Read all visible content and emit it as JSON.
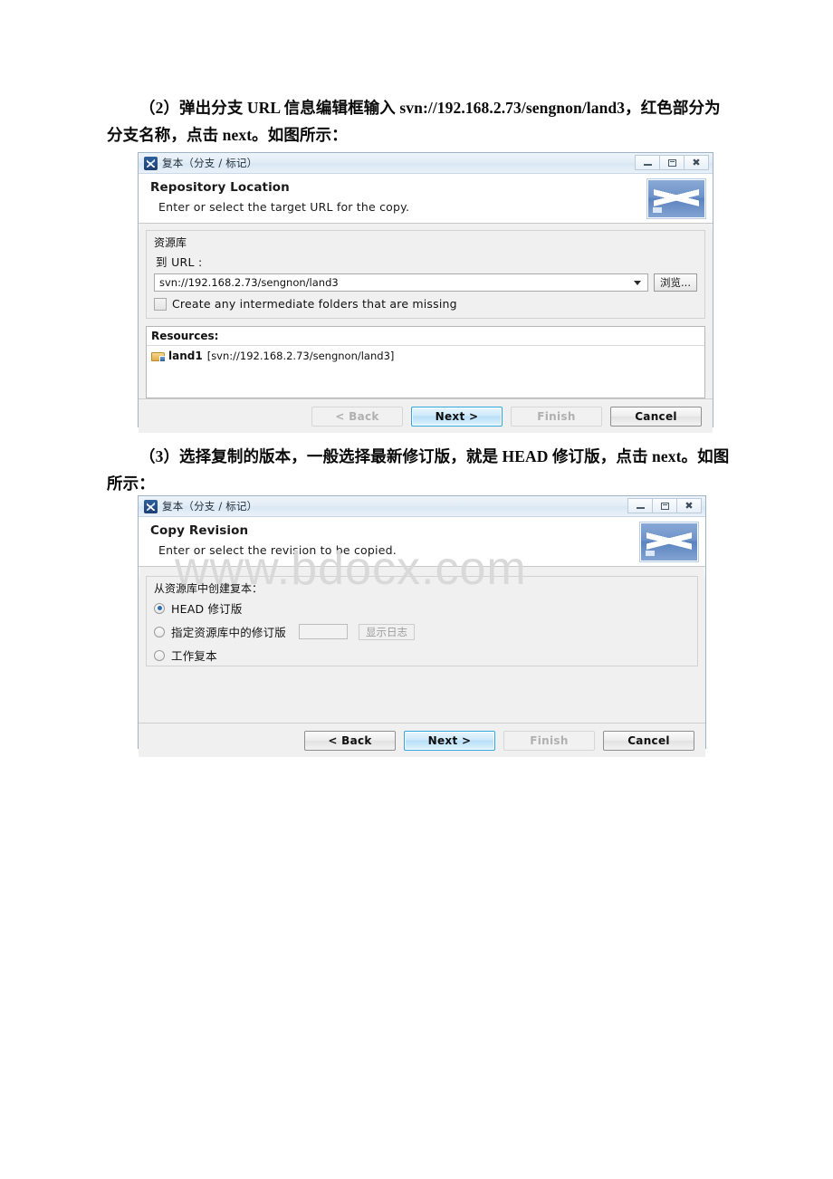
{
  "document": {
    "paragraph_2": "（2）弹出分支 URL 信息编辑框输入 svn://192.168.2.73/sengnon/land3，红色部分为分支名称，点击 next。如图所示：",
    "paragraph_3": "（3）选择复制的版本，一般选择最新修订版，就是 HEAD 修订版，点击 next。如图所示："
  },
  "watermark": {
    "text": "www.bdocx.com",
    "color": "#d8d8d8"
  },
  "dialog1": {
    "titlebar": {
      "title": "复本（分支 / 标记）",
      "icon": "subclipse-icon",
      "minimize_label": "最小化",
      "restore_label": "还原",
      "close_label": "关闭"
    },
    "header": {
      "title": "Repository Location",
      "description": "Enter or select the target URL for the copy.",
      "logo": "svn-logo"
    },
    "group": {
      "label": "资源库",
      "url_field_label": "到 URL :",
      "url_value": "svn://192.168.2.73/sengnon/land3",
      "browse_button": "浏览...",
      "checkbox_label": "Create any intermediate folders that are missing",
      "checkbox_checked": false
    },
    "resources": {
      "title": "Resources:",
      "items": [
        {
          "icon": "folder-icon",
          "name": "land1",
          "url": "[svn://192.168.2.73/sengnon/land3]"
        }
      ]
    },
    "footer": {
      "back": "< Back",
      "back_enabled": false,
      "next": "Next >",
      "next_primary": true,
      "finish": "Finish",
      "finish_enabled": false,
      "cancel": "Cancel"
    }
  },
  "dialog2": {
    "titlebar": {
      "title": "复本（分支 / 标记）",
      "icon": "subclipse-icon",
      "minimize_label": "最小化",
      "restore_label": "还原",
      "close_label": "关闭"
    },
    "header": {
      "title": "Copy Revision",
      "description": "Enter or select the revision to be copied.",
      "logo": "svn-logo"
    },
    "group": {
      "label": "从资源库中创建复本：",
      "options": [
        {
          "label": "HEAD 修订版",
          "selected": true
        },
        {
          "label": "指定资源库中的修订版",
          "selected": false,
          "revision_value": "",
          "log_button": "显示日志",
          "log_button_enabled": false
        },
        {
          "label": "工作复本",
          "selected": false
        }
      ]
    },
    "footer": {
      "back": "< Back",
      "back_enabled": true,
      "next": "Next >",
      "next_primary": true,
      "finish": "Finish",
      "finish_enabled": false,
      "cancel": "Cancel"
    }
  }
}
